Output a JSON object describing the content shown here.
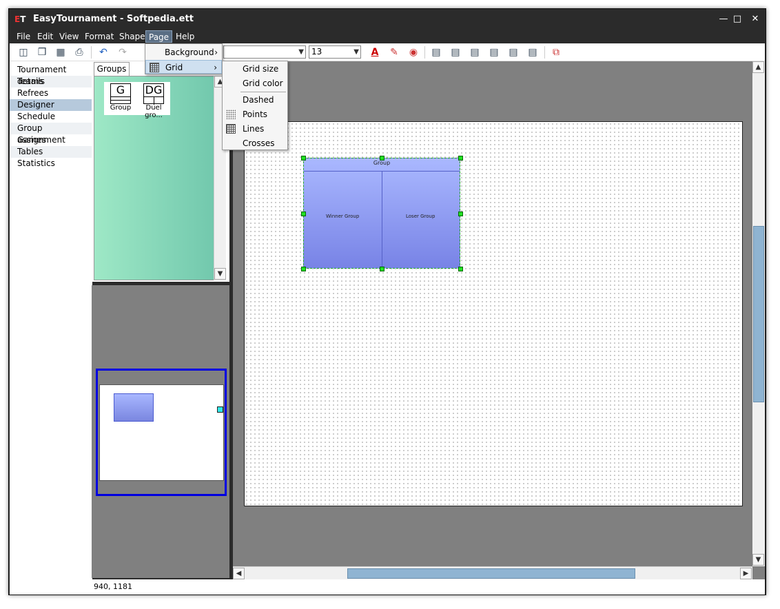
{
  "window": {
    "title": "EasyTournament - Softpedia.ett",
    "app_icon_a": "E",
    "app_icon_b": "T"
  },
  "controls": {
    "minimize": "—",
    "maximize": "□",
    "close": "✕"
  },
  "menubar": [
    "File",
    "Edit",
    "View",
    "Format",
    "Shape",
    "Page",
    "Help"
  ],
  "toolbar": {
    "font_combo_value": "",
    "size_combo_value": "13",
    "icons": [
      "new-icon",
      "open-icon",
      "save-icon",
      "print-icon",
      "undo-icon",
      "redo-icon",
      "font-color-icon",
      "highlight-icon",
      "fill-color-icon",
      "align-left-icon",
      "align-center-icon",
      "align-right-icon",
      "align-top-icon",
      "align-middle-icon",
      "align-bottom-icon",
      "arrange-icon"
    ]
  },
  "nav": [
    "Tournament details",
    "Teams",
    "Refrees",
    "Designer",
    "Schedule",
    "Group assignment",
    "Games",
    "Tables",
    "Statistics"
  ],
  "nav_selected": "Designer",
  "groups_panel": {
    "tab_label": "Groups",
    "items": [
      {
        "icon_text": "G",
        "label": "Group"
      },
      {
        "icon_text": "DG",
        "label": "Duel gro..."
      }
    ]
  },
  "canvas": {
    "shape": {
      "header": "Group",
      "left_label": "Winner Group",
      "right_label": "Loser Group"
    }
  },
  "page_menu": {
    "items": [
      {
        "label": "Background",
        "has_submenu": true
      },
      {
        "label": "Grid",
        "has_submenu": true,
        "highlighted": true
      }
    ]
  },
  "grid_submenu": {
    "items": [
      "Grid size",
      "Grid color",
      "Dashed",
      "Points",
      "Lines",
      "Crosses"
    ]
  },
  "status": {
    "coords": "940, 1181"
  },
  "colors": {
    "title_bg": "#2b2b2b",
    "selection": "#b6c9dc",
    "handle": "#22e022",
    "overview_frame": "#0000e0"
  }
}
